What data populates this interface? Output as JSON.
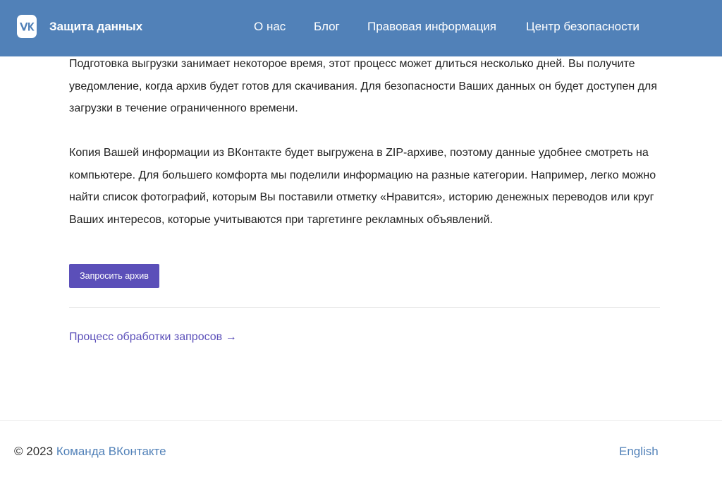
{
  "header": {
    "brand": "Защита данных",
    "nav": {
      "about": "О нас",
      "blog": "Блог",
      "legal": "Правовая информация",
      "safety": "Центр безопасности"
    },
    "logo_icon": "vk-logo-icon"
  },
  "main": {
    "paragraph_1": "Подготовка выгрузки занимает некоторое время, этот процесс может длиться несколько дней. Вы получите уведомление, когда архив будет готов для скачивания. Для безопасности Ваших данных он будет доступен для загрузки в течение ограниченного времени.",
    "paragraph_2": "Копия Вашей информации из ВКонтакте будет выгружена в ZIP-архиве, поэтому данные удобнее смотреть на компьютере. Для большего комфорта мы поделили информацию на разные категории. Например, легко можно найти список фотографий, которым Вы поставили отметку «Нравится», историю денежных переводов или круг Ваших интересов, которые учитываются при таргетинге рекламных объявлений.",
    "request_button": "Запросить архив",
    "process_link": "Процесс обработки запросов →"
  },
  "footer": {
    "copyright": "© 2023",
    "team_link": "Команда ВКонтакте",
    "language_link": "English"
  },
  "colors": {
    "header_bg": "#5181b8",
    "accent": "#5b4fb9",
    "link": "#5181b8"
  }
}
